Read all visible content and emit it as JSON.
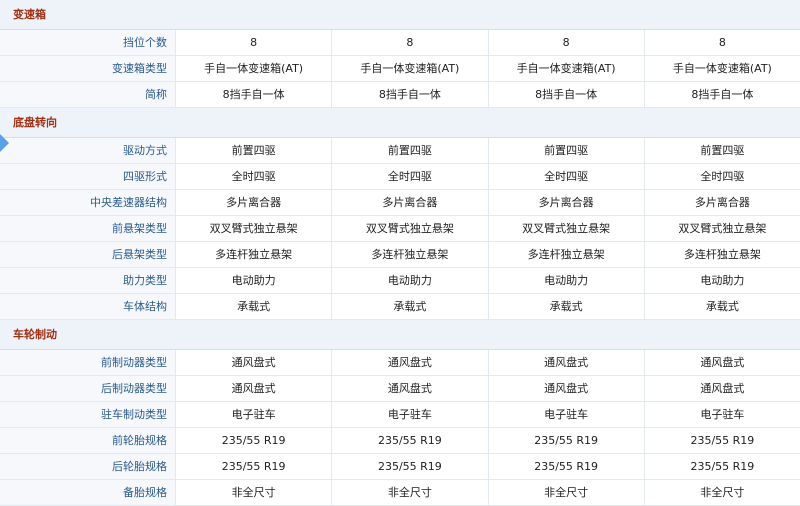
{
  "sections": [
    {
      "title": "变速箱",
      "rows": [
        {
          "label": "挡位个数",
          "values": [
            "8",
            "8",
            "8",
            "8"
          ]
        },
        {
          "label": "变速箱类型",
          "values": [
            "手自一体变速箱(AT)",
            "手自一体变速箱(AT)",
            "手自一体变速箱(AT)",
            "手自一体变速箱(AT)"
          ]
        },
        {
          "label": "简称",
          "values": [
            "8挡手自一体",
            "8挡手自一体",
            "8挡手自一体",
            "8挡手自一体"
          ]
        }
      ]
    },
    {
      "title": "底盘转向",
      "rows": [
        {
          "label": "驱动方式",
          "values": [
            "前置四驱",
            "前置四驱",
            "前置四驱",
            "前置四驱"
          ]
        },
        {
          "label": "四驱形式",
          "values": [
            "全时四驱",
            "全时四驱",
            "全时四驱",
            "全时四驱"
          ]
        },
        {
          "label": "中央差速器结构",
          "values": [
            "多片离合器",
            "多片离合器",
            "多片离合器",
            "多片离合器"
          ]
        },
        {
          "label": "前悬架类型",
          "values": [
            "双叉臂式独立悬架",
            "双叉臂式独立悬架",
            "双叉臂式独立悬架",
            "双叉臂式独立悬架"
          ]
        },
        {
          "label": "后悬架类型",
          "values": [
            "多连杆独立悬架",
            "多连杆独立悬架",
            "多连杆独立悬架",
            "多连杆独立悬架"
          ]
        },
        {
          "label": "助力类型",
          "values": [
            "电动助力",
            "电动助力",
            "电动助力",
            "电动助力"
          ]
        },
        {
          "label": "车体结构",
          "values": [
            "承载式",
            "承载式",
            "承载式",
            "承载式"
          ]
        }
      ]
    },
    {
      "title": "车轮制动",
      "rows": [
        {
          "label": "前制动器类型",
          "values": [
            "通风盘式",
            "通风盘式",
            "通风盘式",
            "通风盘式"
          ]
        },
        {
          "label": "后制动器类型",
          "values": [
            "通风盘式",
            "通风盘式",
            "通风盘式",
            "通风盘式"
          ]
        },
        {
          "label": "驻车制动类型",
          "values": [
            "电子驻车",
            "电子驻车",
            "电子驻车",
            "电子驻车"
          ]
        },
        {
          "label": "前轮胎规格",
          "values": [
            "235/55 R19",
            "235/55 R19",
            "235/55 R19",
            "235/55 R19"
          ]
        },
        {
          "label": "后轮胎规格",
          "values": [
            "235/55 R19",
            "235/55 R19",
            "235/55 R19",
            "235/55 R19"
          ]
        },
        {
          "label": "备胎规格",
          "values": [
            "非全尺寸",
            "非全尺寸",
            "非全尺寸",
            "非全尺寸"
          ]
        }
      ]
    }
  ]
}
